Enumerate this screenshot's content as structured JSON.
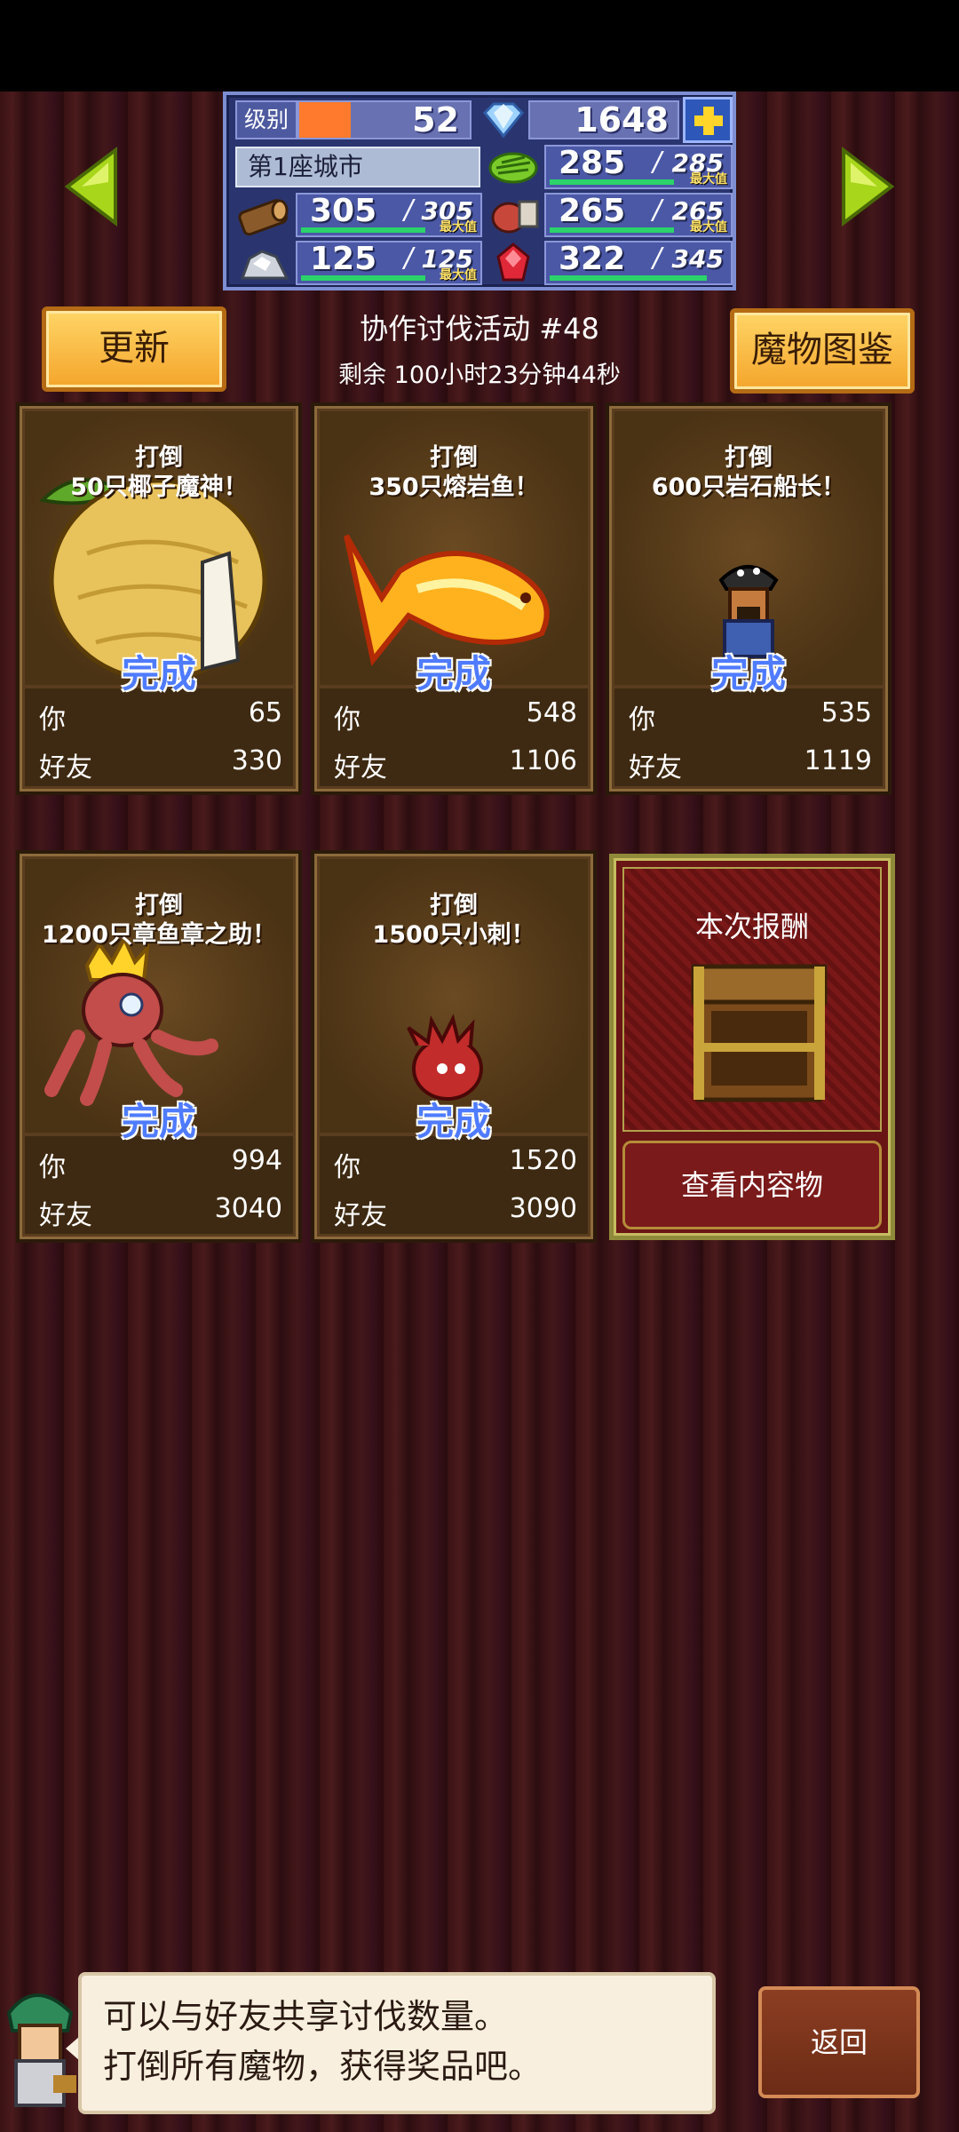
{
  "header": {
    "level_label": "级别",
    "level": "52",
    "level_progress": 0.3,
    "gems": "1648",
    "city": "第1座城市",
    "resources": [
      {
        "icon": "wood-log-icon",
        "value": "305",
        "slash": "/",
        "max": "305",
        "max_label": "最大值",
        "fill": 1.0
      },
      {
        "icon": "grass-icon",
        "value": "285",
        "slash": "/",
        "max": "285",
        "max_label": "最大值",
        "fill": 1.0
      },
      {
        "icon": "meat-icon",
        "value": "265",
        "slash": "/",
        "max": "265",
        "max_label": "最大值",
        "fill": 1.0
      },
      {
        "icon": "ore-rock-icon",
        "value": "125",
        "slash": "/",
        "max": "125",
        "max_label": "最大值",
        "fill": 1.0
      },
      {
        "icon": "ruby-icon",
        "value": "322",
        "slash": "/",
        "max": "345",
        "max_label": "",
        "fill": 0.93
      }
    ]
  },
  "toolbar": {
    "refresh_label": "更新",
    "monster_book_label": "魔物图鉴",
    "event_title": "协作讨伐活动 #48",
    "event_time": "剩余 100小时23分钟44秒"
  },
  "quests": [
    {
      "title_line1": "打倒",
      "title_line2": "50只椰子魔神！",
      "done": "完成",
      "you_label": "你",
      "you": "65",
      "friend_label": "好友",
      "friend": "330"
    },
    {
      "title_line1": "打倒",
      "title_line2": "350只熔岩鱼！",
      "done": "完成",
      "you_label": "你",
      "you": "548",
      "friend_label": "好友",
      "friend": "1106"
    },
    {
      "title_line1": "打倒",
      "title_line2": "600只岩石船长！",
      "done": "完成",
      "you_label": "你",
      "you": "535",
      "friend_label": "好友",
      "friend": "1119"
    },
    {
      "title_line1": "打倒",
      "title_line2": "1200只章鱼章之助！",
      "done": "完成",
      "you_label": "你",
      "you": "994",
      "friend_label": "好友",
      "friend": "3040"
    },
    {
      "title_line1": "打倒",
      "title_line2": "1500只小刺！",
      "done": "完成",
      "you_label": "你",
      "you": "1520",
      "friend_label": "好友",
      "friend": "3090"
    }
  ],
  "reward": {
    "title": "本次报酬",
    "view_label": "查看内容物"
  },
  "dialog": {
    "line1": "可以与好友共享讨伐数量。",
    "line2": "打倒所有魔物，获得奖品吧。"
  },
  "back_label": "返回"
}
